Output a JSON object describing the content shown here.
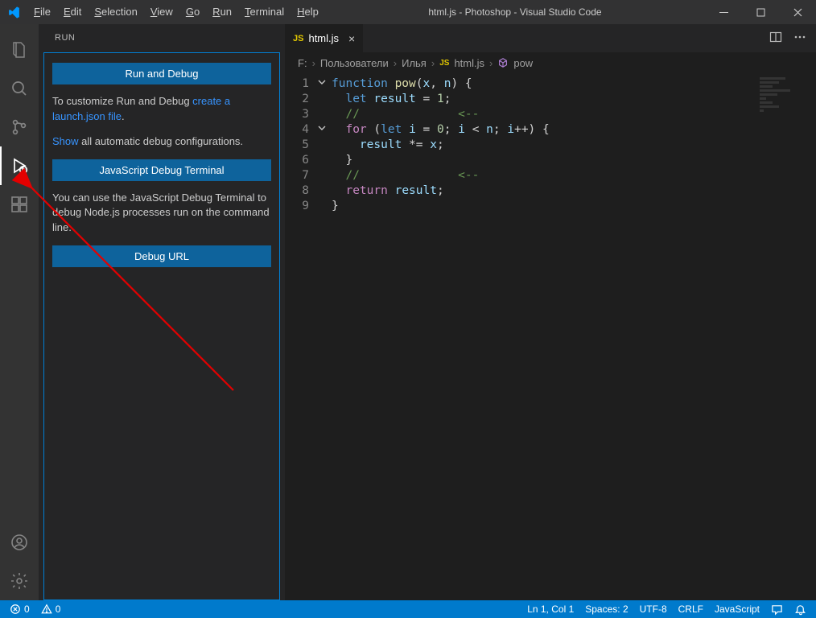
{
  "titlebar": {
    "window_title": "html.js - Photoshop - Visual Studio Code",
    "menus": [
      "File",
      "Edit",
      "Selection",
      "View",
      "Go",
      "Run",
      "Terminal",
      "Help"
    ]
  },
  "activitybar": {
    "items": [
      {
        "name": "explorer-icon"
      },
      {
        "name": "search-icon"
      },
      {
        "name": "source-control-icon"
      },
      {
        "name": "run-debug-icon",
        "active": true
      },
      {
        "name": "extensions-icon"
      }
    ],
    "bottom": [
      {
        "name": "accounts-icon"
      },
      {
        "name": "settings-gear-icon"
      }
    ]
  },
  "sidebar": {
    "title": "RUN",
    "run_debug_btn": "Run and Debug",
    "customize_pre": "To customize Run and Debug ",
    "customize_link": "create a launch.json file",
    "customize_post": ".",
    "show_link": "Show",
    "show_rest": " all automatic debug configurations.",
    "js_debug_btn": "JavaScript Debug Terminal",
    "js_debug_desc": "You can use the JavaScript Debug Terminal to debug Node.js processes run on the command line.",
    "debug_url_btn": "Debug URL"
  },
  "tabs": {
    "items": [
      {
        "icon": "JS",
        "label": "html.js",
        "dirty": false
      }
    ]
  },
  "breadcrumb": {
    "parts": [
      "F:",
      "Пользователи",
      "Илья"
    ],
    "file_icon": "JS",
    "file": "html.js",
    "symbol": "pow"
  },
  "code": {
    "lines": [
      {
        "n": 1,
        "fold": "v",
        "html": "<span class='tok-kw2'>function</span> <span class='tok-fn'>pow</span><span class='tok-pun'>(</span><span class='tok-var'>x</span><span class='tok-pun'>, </span><span class='tok-var'>n</span><span class='tok-pun'>) {</span>"
      },
      {
        "n": 2,
        "fold": "",
        "html": "  <span class='tok-kw2'>let</span> <span class='tok-var'>result</span> <span class='tok-pun'>=</span> <span class='tok-num'>1</span><span class='tok-pun'>;</span>"
      },
      {
        "n": 3,
        "fold": "",
        "html": "  <span class='tok-com'>//              &lt;--</span>"
      },
      {
        "n": 4,
        "fold": "v",
        "html": "  <span class='tok-kw'>for</span> <span class='tok-pun'>(</span><span class='tok-kw2'>let</span> <span class='tok-var'>i</span> <span class='tok-pun'>=</span> <span class='tok-num'>0</span><span class='tok-pun'>; </span><span class='tok-var'>i</span> <span class='tok-pun'>&lt;</span> <span class='tok-var'>n</span><span class='tok-pun'>; </span><span class='tok-var'>i</span><span class='tok-pun'>++) {</span>"
      },
      {
        "n": 5,
        "fold": "",
        "html": "    <span class='tok-var'>result</span> <span class='tok-pun'>*=</span> <span class='tok-var'>x</span><span class='tok-pun'>;</span>"
      },
      {
        "n": 6,
        "fold": "",
        "html": "  <span class='tok-pun'>}</span>"
      },
      {
        "n": 7,
        "fold": "",
        "html": "  <span class='tok-com'>//              &lt;--</span>"
      },
      {
        "n": 8,
        "fold": "",
        "html": "  <span class='tok-kw'>return</span> <span class='tok-var'>result</span><span class='tok-pun'>;</span>"
      },
      {
        "n": 9,
        "fold": "",
        "html": "<span class='tok-pun'>}</span>"
      }
    ]
  },
  "status": {
    "errors": "0",
    "warnings": "0",
    "ln_col": "Ln 1, Col 1",
    "spaces": "Spaces: 2",
    "encoding": "UTF-8",
    "eol": "CRLF",
    "lang": "JavaScript"
  }
}
